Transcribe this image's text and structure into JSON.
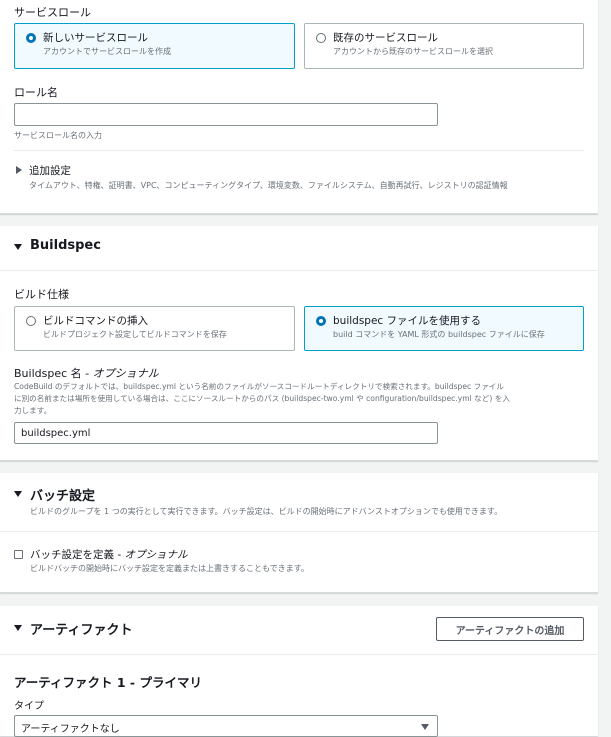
{
  "service_role": {
    "label": "サービスロール",
    "options": [
      {
        "title": "新しいサービスロール",
        "desc": "アカウントでサービスロールを作成",
        "selected": true
      },
      {
        "title": "既存のサービスロール",
        "desc": "アカウントから既存のサービスロールを選択",
        "selected": false
      }
    ]
  },
  "role_name": {
    "label": "ロール名",
    "value": "",
    "hint": "サービスロール名の入力"
  },
  "additional": {
    "title": "追加設定",
    "desc": "タイムアウト、特権、証明書、VPC、コンピューティングタイプ、環境変数、ファイルシステム、自動再試行、レジストリの認証情報"
  },
  "buildspec": {
    "title": "Buildspec",
    "spec_label": "ビルド仕様",
    "options": [
      {
        "title": "ビルドコマンドの挿入",
        "desc": "ビルドプロジェクト設定してビルドコマンドを保存",
        "selected": false
      },
      {
        "title": "buildspec ファイルを使用する",
        "desc": "build コマンドを YAML 形式の buildspec ファイルに保存",
        "selected": true
      }
    ],
    "name_label": "Buildspec 名",
    "name_optional": " - オプショナル",
    "name_desc_1": "CodeBuild のデフォルトでは、buildspec.yml という名前のファイルがソースコードルートディレクトリで検索されます。buildspec ファイル",
    "name_desc_2": "に別の名前または場所を使用している場合は、ここにソースルートからのパス (buildspec-two.yml や configuration/buildspec.yml など) を入",
    "name_desc_3": "力します。",
    "name_value": "buildspec.yml"
  },
  "batch": {
    "title": "バッチ設定",
    "desc": "ビルドのグループを 1 つの実行として実行できます。バッチ設定は、ビルドの開始時にアドバンストオプションでも使用できます。",
    "checkbox_label": "バッチ設定を定義",
    "checkbox_optional": " - オプショナル",
    "checkbox_checked": false,
    "checkbox_desc": "ビルドバッチの開始時にバッチ設定を定義または上書きすることもできます。"
  },
  "artifacts": {
    "title": "アーティファクト",
    "add_button": "アーティファクトの追加",
    "artifact1_title": "アーティファクト 1 - プライマリ",
    "type_label": "タイプ",
    "type_value": "アーティファクトなし"
  },
  "colors": {
    "accent": "#0073bb",
    "selected_border": "#00a1c9",
    "selected_bg": "#f1faff",
    "page_bg": "#f2f3f3"
  }
}
